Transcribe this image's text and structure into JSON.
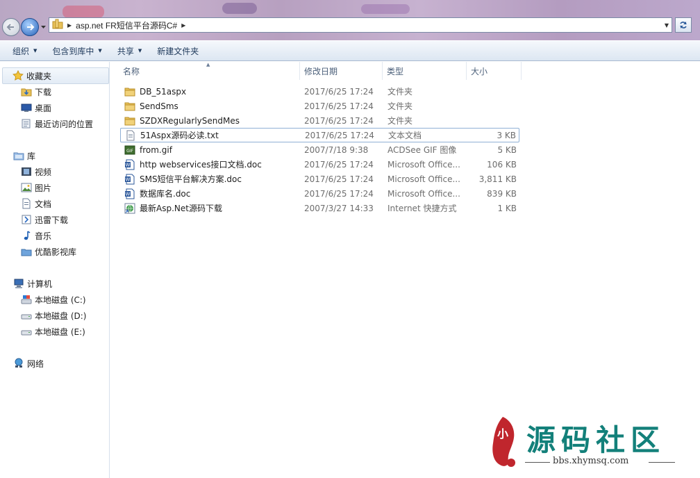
{
  "address": {
    "path": [
      "asp.net FR短信平台源码C#"
    ]
  },
  "toolbar": {
    "organize": "组织",
    "include_library": "包含到库中",
    "share": "共享",
    "new_folder": "新建文件夹"
  },
  "sidebar": {
    "favorites": "收藏夹",
    "fav_items": [
      "下载",
      "桌面",
      "最近访问的位置"
    ],
    "libraries": "库",
    "lib_items": [
      "视频",
      "图片",
      "文档",
      "迅雷下载",
      "音乐",
      "优酷影视库"
    ],
    "computer": "计算机",
    "drives": [
      "本地磁盘 (C:)",
      "本地磁盘 (D:)",
      "本地磁盘 (E:)"
    ],
    "network": "网络"
  },
  "columns": {
    "name": "名称",
    "date": "修改日期",
    "type": "类型",
    "size": "大小"
  },
  "files": [
    {
      "name": "DB_51aspx",
      "date": "2017/6/25 17:24",
      "type": "文件夹",
      "size": "",
      "icon": "folder-icon"
    },
    {
      "name": "SendSms",
      "date": "2017/6/25 17:24",
      "type": "文件夹",
      "size": "",
      "icon": "folder-icon"
    },
    {
      "name": "SZDXRegularlySendMes",
      "date": "2017/6/25 17:24",
      "type": "文件夹",
      "size": "",
      "icon": "folder-icon"
    },
    {
      "name": "51Aspx源码必读.txt",
      "date": "2017/6/25 17:24",
      "type": "文本文档",
      "size": "3 KB",
      "icon": "text-file-icon"
    },
    {
      "name": "from.gif",
      "date": "2007/7/18 9:38",
      "type": "ACDSee GIF 图像",
      "size": "5 KB",
      "icon": "gif-image-icon"
    },
    {
      "name": "http webservices接口文档.doc",
      "date": "2017/6/25 17:24",
      "type": "Microsoft Office...",
      "size": "106 KB",
      "icon": "word-doc-icon"
    },
    {
      "name": "SMS短信平台解决方案.doc",
      "date": "2017/6/25 17:24",
      "type": "Microsoft Office...",
      "size": "3,811 KB",
      "icon": "word-doc-icon"
    },
    {
      "name": "数据库名.doc",
      "date": "2017/6/25 17:24",
      "type": "Microsoft Office...",
      "size": "839 KB",
      "icon": "word-doc-icon"
    },
    {
      "name": "最新Asp.Net源码下载",
      "date": "2007/3/27 14:33",
      "type": "Internet 快捷方式",
      "size": "1 KB",
      "icon": "internet-shortcut-icon"
    }
  ],
  "watermark": {
    "seal_text": "小",
    "title": "源码社区",
    "url": "bbs.xhymsq.com"
  },
  "colors": {
    "accent": "#1e395b",
    "watermark": "#13807a",
    "seal": "#c0262d"
  }
}
